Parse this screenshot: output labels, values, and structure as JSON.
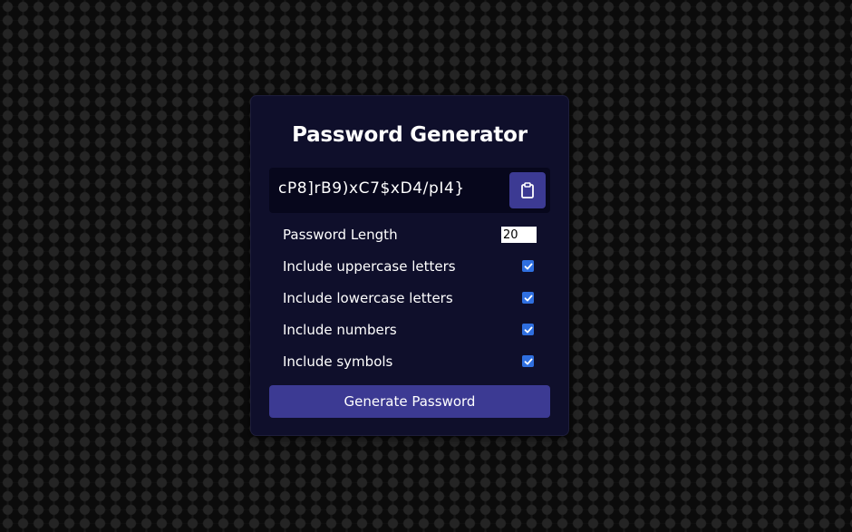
{
  "app": {
    "title": "Password Generator"
  },
  "result": {
    "password": "cP8]rB9)xC7$xD4/pI4}",
    "copy_icon": "clipboard-icon"
  },
  "settings": {
    "length": {
      "label": "Password Length",
      "value": "20"
    },
    "options": [
      {
        "label": "Include uppercase letters",
        "checked": true
      },
      {
        "label": "Include lowercase letters",
        "checked": true
      },
      {
        "label": "Include numbers",
        "checked": true
      },
      {
        "label": "Include symbols",
        "checked": true
      }
    ]
  },
  "generate_button": {
    "label": "Generate Password"
  },
  "colors": {
    "card_bg": "#0f0f2b",
    "result_bg": "#07071c",
    "accent": "#3c3a93",
    "checkbox": "#2f6fe0"
  }
}
